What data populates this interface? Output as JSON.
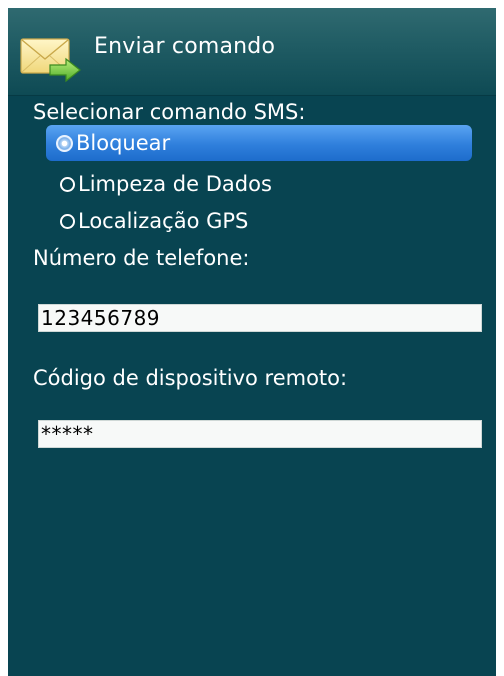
{
  "header": {
    "title": "Enviar comando",
    "icon": "mail-send-icon"
  },
  "sms_section": {
    "label": "Selecionar comando SMS:",
    "options": [
      {
        "label": "Bloquear",
        "selected": true
      },
      {
        "label": "Limpeza de Dados",
        "selected": false
      },
      {
        "label": "Localização GPS",
        "selected": false
      }
    ]
  },
  "phone": {
    "label": "Número de telefone:",
    "value": "123456789"
  },
  "remote_code": {
    "label": "Código de dispositivo remoto:",
    "value": "*****"
  },
  "colors": {
    "background": "#084451",
    "selection": "#2f7fdc",
    "text": "#ffffff"
  }
}
